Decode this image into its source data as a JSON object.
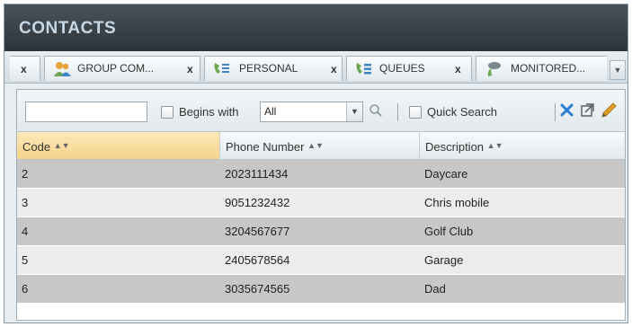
{
  "window": {
    "title": "CONTACTS"
  },
  "tabs": {
    "partial_close": "x",
    "items": [
      {
        "label": "GROUP COM...",
        "icon": "group-contacts-icon",
        "close": "x"
      },
      {
        "label": "PERSONAL",
        "icon": "personal-contacts-icon",
        "close": "x"
      },
      {
        "label": "QUEUES",
        "icon": "queues-icon",
        "close": "x"
      },
      {
        "label": "MONITORED...",
        "icon": "monitored-icon"
      }
    ],
    "overflow_icon": "chevron-down-icon"
  },
  "toolbar": {
    "search_value": "",
    "begins_with_label": "Begins with",
    "filter_value": "All",
    "quick_search_label": "Quick Search",
    "icons": [
      "magnifier-icon",
      "delete-x-icon",
      "popout-icon",
      "edit-pencil-icon"
    ],
    "accent_colors": {
      "delete": "#2a7fd4",
      "edit": "#e0a020"
    }
  },
  "table": {
    "columns": [
      "Code",
      "Phone Number",
      "Description"
    ],
    "sorted_column": "Code",
    "rows": [
      {
        "code": "2",
        "phone": "2023111434",
        "description": "Daycare"
      },
      {
        "code": "3",
        "phone": "9051232432",
        "description": "Chris mobile"
      },
      {
        "code": "4",
        "phone": "3204567677",
        "description": "Golf Club"
      },
      {
        "code": "5",
        "phone": "2405678564",
        "description": "Garage"
      },
      {
        "code": "6",
        "phone": "3035674565",
        "description": "Dad"
      }
    ]
  },
  "colors": {
    "header_bg": "#353c42",
    "title": "#c6d7e6",
    "sorted_header": "#f6d48a",
    "row_dark": "#c7c7c7",
    "row_light": "#ececec"
  }
}
